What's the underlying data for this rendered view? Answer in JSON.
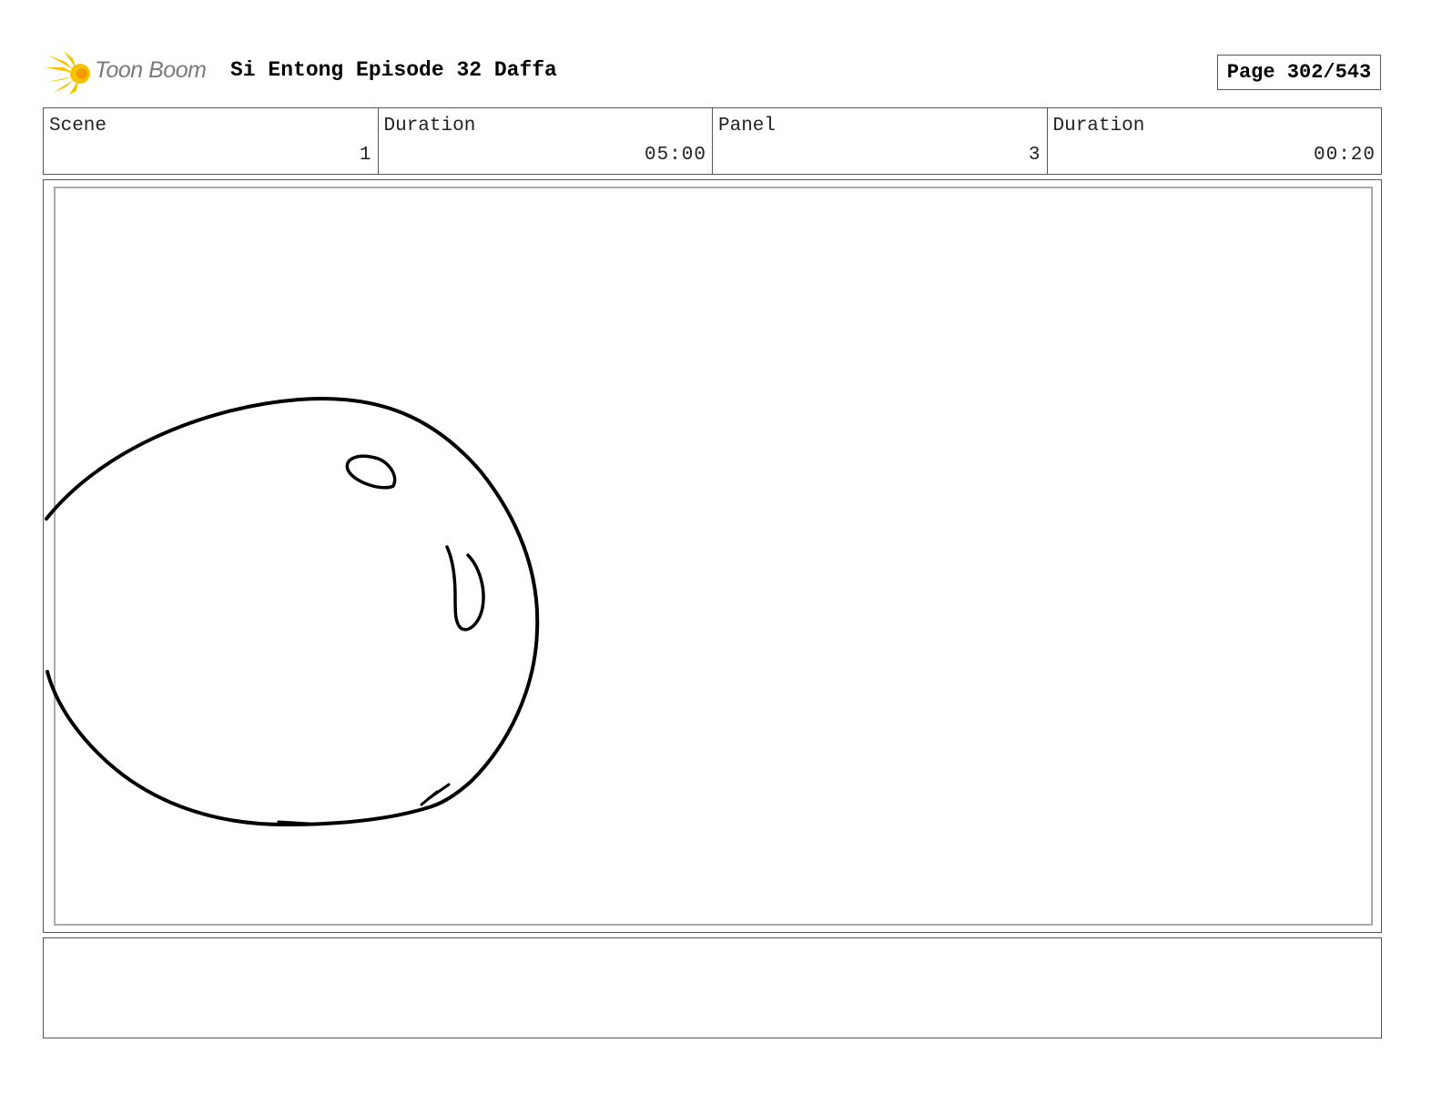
{
  "header": {
    "logo_text": "Toon Boom",
    "title": "Si Entong Episode 32 Daffa",
    "page_counter": "Page 302/543"
  },
  "info": {
    "scene_label": "Scene",
    "scene_value": "1",
    "scene_duration_label": "Duration",
    "scene_duration_value": "05:00",
    "panel_label": "Panel",
    "panel_value": "3",
    "panel_duration_label": "Duration",
    "panel_duration_value": "00:20"
  },
  "panel": {
    "drawing_icon": "character-head-sketch"
  },
  "notes": {
    "text": ""
  },
  "colors": {
    "logo_yellow": "#f5c400",
    "logo_orange": "#f29a00",
    "logo_text": "#7a7a7a"
  }
}
